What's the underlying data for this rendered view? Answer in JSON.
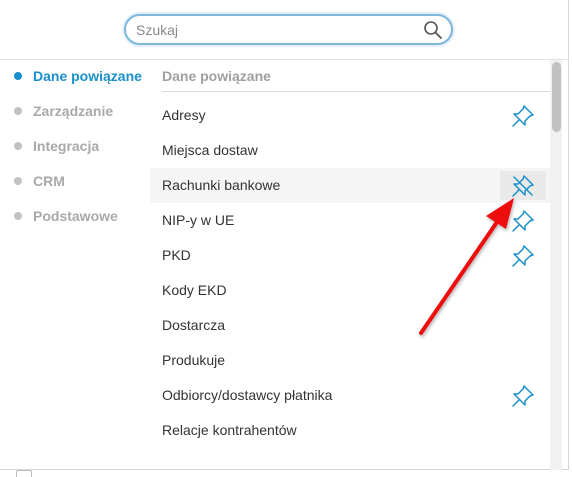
{
  "search": {
    "placeholder": "Szukaj",
    "value": ""
  },
  "sidebar": {
    "items": [
      {
        "label": "Dane powiązane",
        "active": true
      },
      {
        "label": "Zarządzanie",
        "active": false
      },
      {
        "label": "Integracja",
        "active": false
      },
      {
        "label": "CRM",
        "active": false
      },
      {
        "label": "Podstawowe",
        "active": false
      }
    ]
  },
  "list": {
    "header": "Dane powiązane",
    "rows": [
      {
        "label": "Adresy",
        "pin": "pinned"
      },
      {
        "label": "Miejsca dostaw",
        "pin": "none"
      },
      {
        "label": "Rachunki bankowe",
        "pin": "unpin-hover"
      },
      {
        "label": "NIP-y w UE",
        "pin": "pinned"
      },
      {
        "label": "PKD",
        "pin": "pinned"
      },
      {
        "label": "Kody EKD",
        "pin": "none"
      },
      {
        "label": "Dostarcza",
        "pin": "none"
      },
      {
        "label": "Produkuje",
        "pin": "none"
      },
      {
        "label": "Odbiorcy/dostawcy płatnika",
        "pin": "pinned"
      },
      {
        "label": "Relacje kontrahentów",
        "pin": "none"
      }
    ]
  },
  "colors": {
    "accent": "#1a8fcc",
    "annotation_arrow": "#ee1111"
  }
}
